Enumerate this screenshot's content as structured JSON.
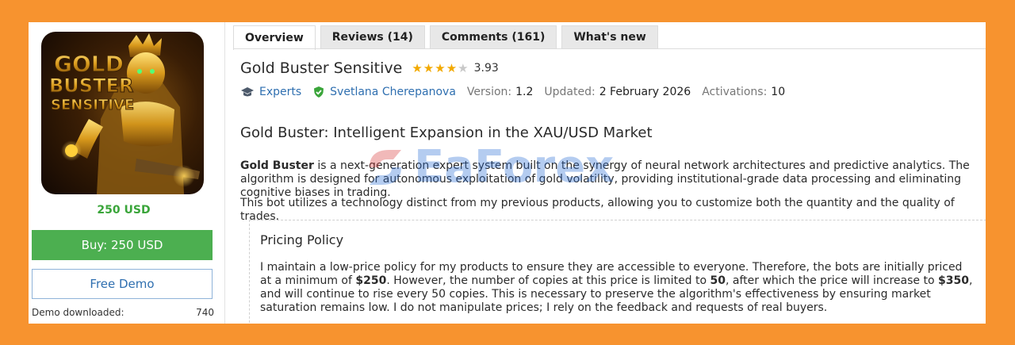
{
  "product": {
    "image_text": [
      "GOLD",
      "BUSTER",
      "SENSITIVE"
    ],
    "price": "250 USD",
    "buy_label": "Buy: 250 USD",
    "demo_label": "Free Demo",
    "demo_downloaded_label": "Demo downloaded:",
    "demo_downloaded_count": "740"
  },
  "tabs": [
    "Overview",
    "Reviews (14)",
    "Comments (161)",
    "What's new"
  ],
  "active_tab": "Overview",
  "header": {
    "title": "Gold Buster Sensitive",
    "rating_value": 3.93,
    "rating": "3.93",
    "category": "Experts",
    "author": "Svetlana Cherepanova",
    "version_label": "Version:",
    "version": "1.2",
    "updated_label": "Updated:",
    "updated": "2 February 2026",
    "activations_label": "Activations:",
    "activations": "10"
  },
  "content": {
    "heading": "Gold Buster: Intelligent Expansion in the XAU/USD Market",
    "p1_bold": "Gold Buster",
    "p1_rest": " is a next-generation expert system built on the synergy of neural network architectures and predictive analytics. The algorithm is designed for autonomous exploitation of gold volatility, providing institutional-grade data processing and eliminating cognitive biases in trading.",
    "p2": "This bot utilizes a technology distinct from my previous products, allowing you to customize both the quantity and the quality of trades.",
    "pricing_title": "Pricing Policy",
    "pricing_t1": "I maintain a low-price policy for my products to ensure they are accessible to everyone. Therefore, the bots are initially priced at a minimum of ",
    "pricing_b1": "$250",
    "pricing_t2": ". However, the number of copies at this price is limited to ",
    "pricing_b2": "50",
    "pricing_t3": ", after which the price will increase to ",
    "pricing_b3": "$350",
    "pricing_t4": ", and will continue to rise every 50 copies. This is necessary to preserve the algorithm's effectiveness by ensuring market saturation remains low. I do not manipulate prices; I rely on the feedback and requests of real buyers."
  },
  "watermark": "EaForex",
  "colors": {
    "background": "#f7932f",
    "buy_green": "#4caf50",
    "link_blue": "#2f6fb0",
    "star": "#f2a900"
  }
}
